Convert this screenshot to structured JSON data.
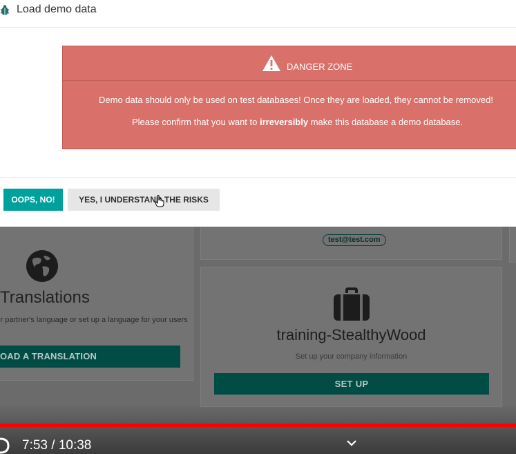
{
  "modal": {
    "title": "Load demo data",
    "danger": {
      "heading": "DANGER ZONE",
      "line1": "Demo data should only be used on test databases! Once they are loaded, they cannot be removed!",
      "line2_prefix": "Please confirm that you want to ",
      "line2_bold": "irreversibly",
      "line2_suffix": " make this database a demo database."
    },
    "buttons": {
      "cancel": "OOPS, NO!",
      "confirm": "YES, I UNDERSTAND THE RISKS"
    }
  },
  "background": {
    "translations": {
      "title": "Translations",
      "description": "our partner's language or set up a language for your users",
      "button": "OAD A TRANSLATION"
    },
    "email_badge": "test@test.com",
    "company": {
      "title": "training-StealthyWood",
      "description": "Set up your company information",
      "button": "SET UP"
    }
  },
  "player": {
    "time": "7:53 / 10:38",
    "progress": 0.74
  },
  "colors": {
    "danger_bg": "#d9706a",
    "primary": "#00a09d",
    "progress": "#ff0000",
    "teal_dark": "#014d46"
  }
}
